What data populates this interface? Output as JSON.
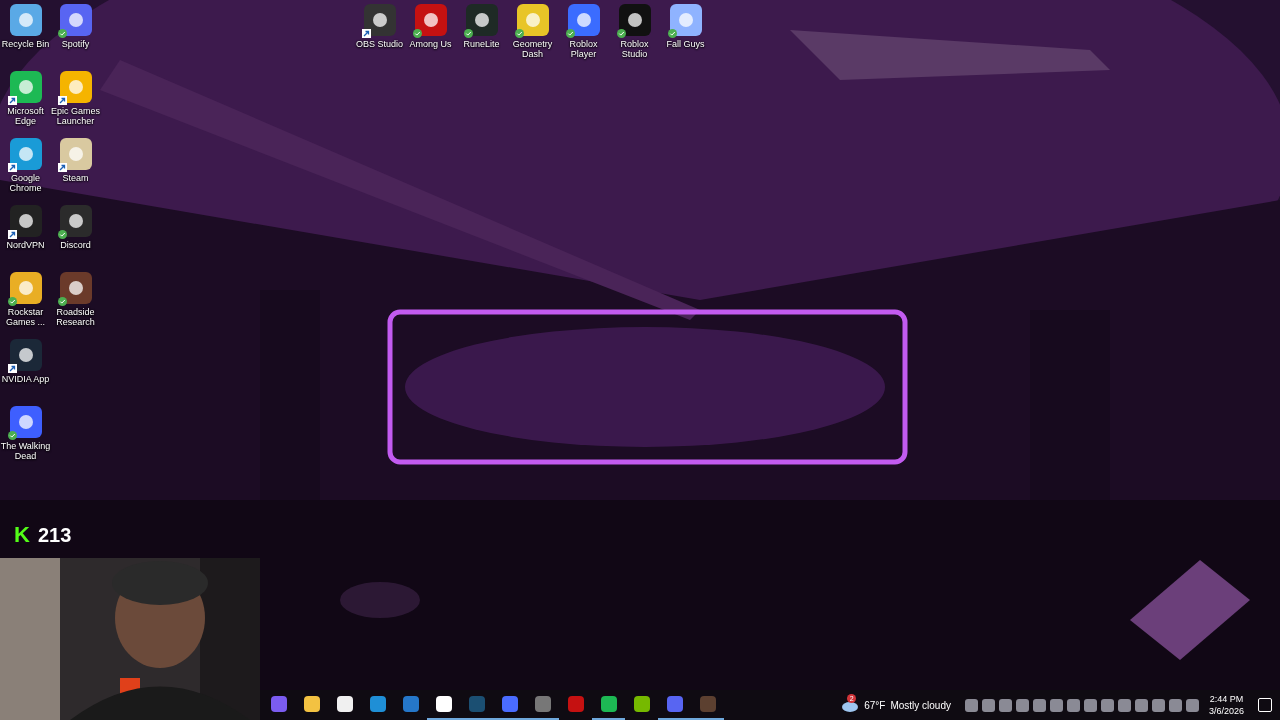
{
  "desktop": {
    "columns": [
      [
        {
          "label": "Recycle Bin",
          "shortcut": false,
          "synced": false
        },
        {
          "label": "Microsoft Edge",
          "shortcut": true,
          "synced": false
        },
        {
          "label": "Google Chrome",
          "shortcut": true,
          "synced": false
        },
        {
          "label": "NordVPN",
          "shortcut": true,
          "synced": false
        },
        {
          "label": "Rockstar Games ...",
          "shortcut": false,
          "synced": true
        },
        {
          "label": "NVIDIA App",
          "shortcut": true,
          "synced": false
        },
        {
          "label": "The Walking Dead",
          "shortcut": false,
          "synced": true
        }
      ],
      [
        {
          "label": "Spotify",
          "shortcut": false,
          "synced": true
        },
        {
          "label": "Epic Games Launcher",
          "shortcut": true,
          "synced": false
        },
        {
          "label": "Steam",
          "shortcut": true,
          "synced": false
        },
        {
          "label": "Discord",
          "shortcut": false,
          "synced": true
        },
        {
          "label": "Roadside Research",
          "shortcut": false,
          "synced": true
        }
      ]
    ],
    "top_row": [
      {
        "label": "OBS Studio",
        "shortcut": true,
        "synced": false
      },
      {
        "label": "Among Us",
        "shortcut": false,
        "synced": true
      },
      {
        "label": "RuneLite",
        "shortcut": false,
        "synced": true
      },
      {
        "label": "Geometry Dash",
        "shortcut": false,
        "synced": true
      },
      {
        "label": "Roblox Player",
        "shortcut": false,
        "synced": true
      },
      {
        "label": "Roblox Studio",
        "shortcut": false,
        "synced": true
      },
      {
        "label": "Fall Guys",
        "shortcut": false,
        "synced": true
      }
    ]
  },
  "overlay": {
    "logo": "K",
    "viewers": "213"
  },
  "taskbar": {
    "apps": [
      {
        "running": false
      },
      {
        "running": false
      },
      {
        "running": false
      },
      {
        "running": false
      },
      {
        "running": false
      },
      {
        "running": true
      },
      {
        "running": true
      },
      {
        "running": true
      },
      {
        "running": true
      },
      {
        "running": false
      },
      {
        "running": true
      },
      {
        "running": false
      },
      {
        "running": true
      },
      {
        "running": true
      }
    ],
    "weather": {
      "badge": "2",
      "temperature": "67°F",
      "condition": "Mostly cloudy"
    },
    "time": "2:44 PM",
    "date": "3/6/2026"
  }
}
